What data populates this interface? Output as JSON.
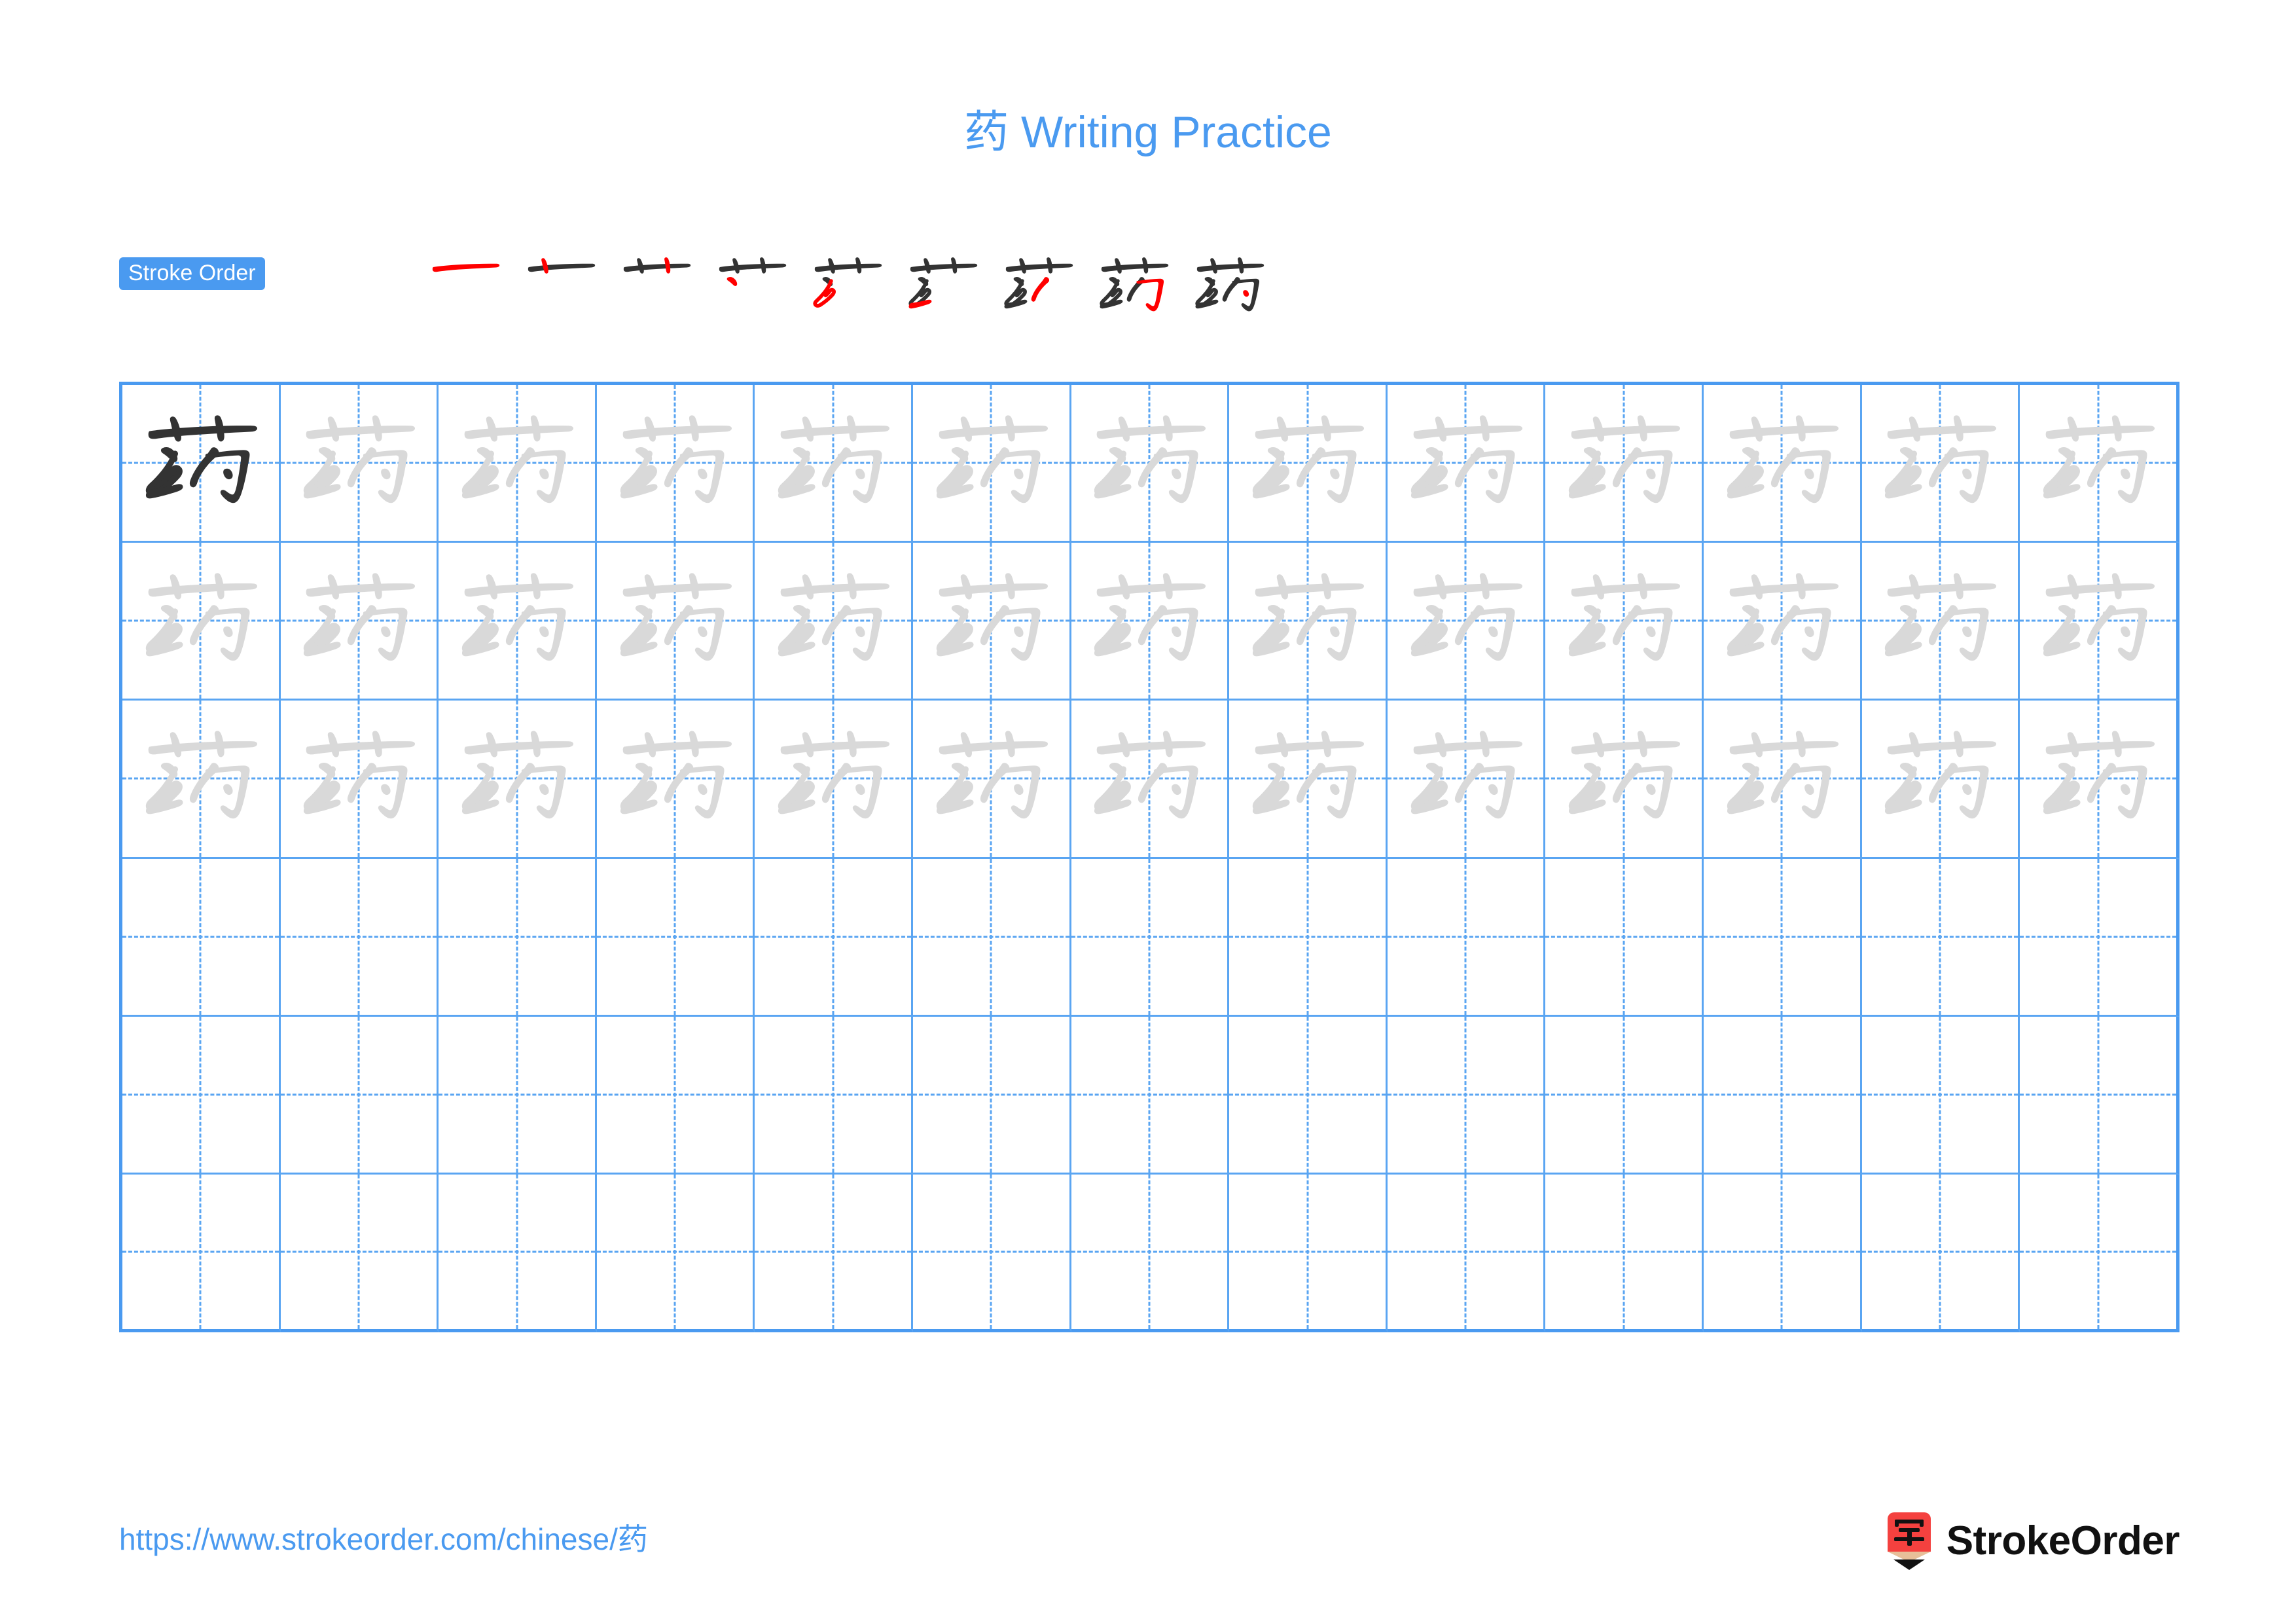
{
  "page": {
    "character": "药",
    "title": "药 Writing Practice",
    "accent_color": "#4a9af0",
    "grid_line_color": "#5aa5f2",
    "trace_color": "#d9d9d9",
    "model_color": "#333333",
    "highlight_stroke_color": "#ff0000"
  },
  "stroke_order": {
    "badge_label": "Stroke Order",
    "total_strokes": 9,
    "steps": [
      {
        "index": 1,
        "strokes_shown": 1,
        "new_stroke": 1
      },
      {
        "index": 2,
        "strokes_shown": 2,
        "new_stroke": 2
      },
      {
        "index": 3,
        "strokes_shown": 3,
        "new_stroke": 3
      },
      {
        "index": 4,
        "strokes_shown": 4,
        "new_stroke": 4
      },
      {
        "index": 5,
        "strokes_shown": 5,
        "new_stroke": 5
      },
      {
        "index": 6,
        "strokes_shown": 6,
        "new_stroke": 6
      },
      {
        "index": 7,
        "strokes_shown": 7,
        "new_stroke": 7
      },
      {
        "index": 8,
        "strokes_shown": 8,
        "new_stroke": 8
      },
      {
        "index": 9,
        "strokes_shown": 9,
        "new_stroke": 9
      }
    ]
  },
  "practice_grid": {
    "columns": 13,
    "rows": 6,
    "cells": [
      [
        "model",
        "trace",
        "trace",
        "trace",
        "trace",
        "trace",
        "trace",
        "trace",
        "trace",
        "trace",
        "trace",
        "trace",
        "trace"
      ],
      [
        "trace",
        "trace",
        "trace",
        "trace",
        "trace",
        "trace",
        "trace",
        "trace",
        "trace",
        "trace",
        "trace",
        "trace",
        "trace"
      ],
      [
        "trace",
        "trace",
        "trace",
        "trace",
        "trace",
        "trace",
        "trace",
        "trace",
        "trace",
        "trace",
        "trace",
        "trace",
        "trace"
      ],
      [
        "empty",
        "empty",
        "empty",
        "empty",
        "empty",
        "empty",
        "empty",
        "empty",
        "empty",
        "empty",
        "empty",
        "empty",
        "empty"
      ],
      [
        "empty",
        "empty",
        "empty",
        "empty",
        "empty",
        "empty",
        "empty",
        "empty",
        "empty",
        "empty",
        "empty",
        "empty",
        "empty"
      ],
      [
        "empty",
        "empty",
        "empty",
        "empty",
        "empty",
        "empty",
        "empty",
        "empty",
        "empty",
        "empty",
        "empty",
        "empty",
        "empty"
      ]
    ]
  },
  "footer": {
    "url": "https://www.strokeorder.com/chinese/药",
    "brand_name": "StrokeOrder",
    "brand_icon_char": "字"
  }
}
